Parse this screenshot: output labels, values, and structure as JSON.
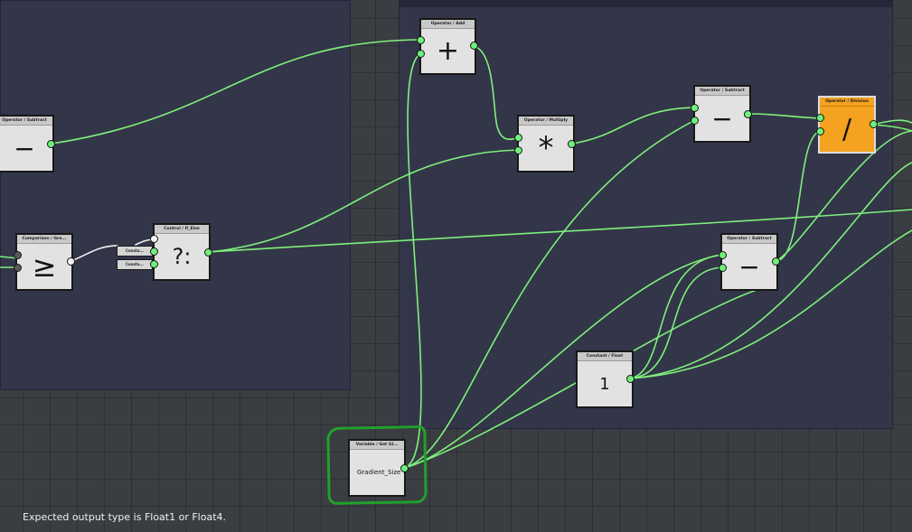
{
  "colors": {
    "wire": "#7ef07c",
    "port": "#6ff07a",
    "node_body": "#e2e2e2",
    "orange_node": "#f4a21f",
    "group": "#333649",
    "highlight": "#20a02a"
  },
  "nodes": {
    "add": {
      "title": "Operator / Add",
      "symbol": "+"
    },
    "subtract_left": {
      "title": "Operator / Subtract",
      "symbol": "−"
    },
    "multiply": {
      "title": "Operator / Multiply",
      "symbol": "*"
    },
    "subtract_top": {
      "title": "Operator / Subtract",
      "symbol": "−"
    },
    "divide": {
      "title": "Operator / Division",
      "symbol": "/"
    },
    "compare": {
      "title": "Comparison / Gre...",
      "symbol": "≥"
    },
    "conditional": {
      "title": "Control / If_Else",
      "symbol": "?:"
    },
    "subtract_mid": {
      "title": "Operator / Subtract",
      "symbol": "−"
    },
    "constant": {
      "title": "Constant / Float",
      "value": "1"
    },
    "variable": {
      "title": "Variable / Get Gl...",
      "label": "Gradient_Size"
    }
  },
  "chips": [
    "Consta...",
    "Consta..."
  ],
  "status_message": "Expected output type is Float1 or Float4."
}
